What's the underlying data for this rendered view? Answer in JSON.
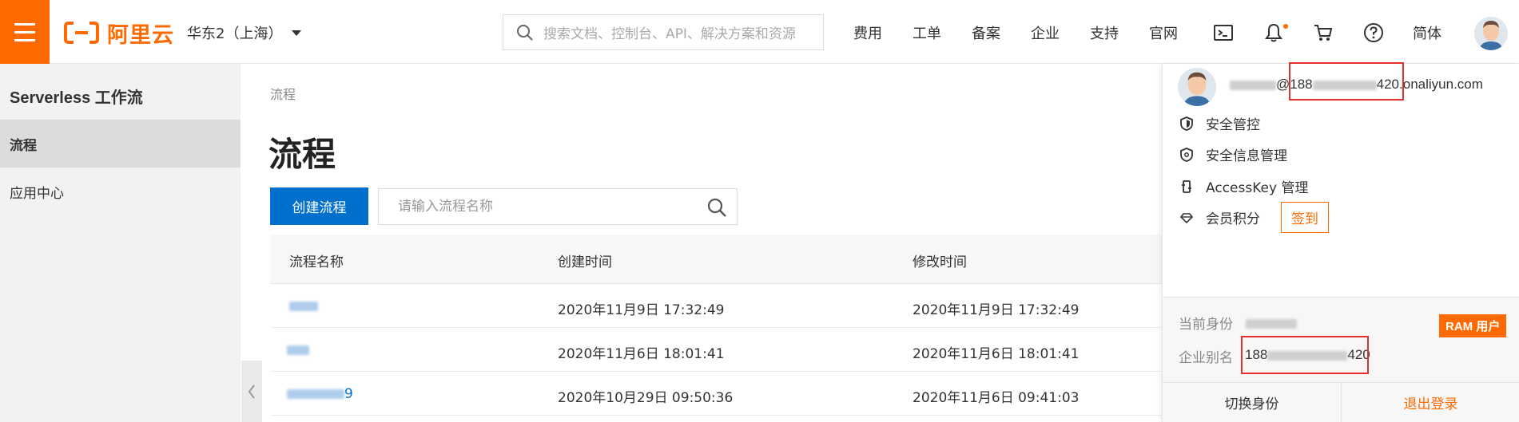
{
  "topbar": {
    "logo_text": "阿里云",
    "region": "华东2（上海）",
    "search_placeholder": "搜索文档、控制台、API、解决方案和资源",
    "nav": [
      "费用",
      "工单",
      "备案",
      "企业",
      "支持",
      "官网"
    ],
    "icons": [
      "terminal-icon",
      "bell-icon",
      "cart-icon",
      "help-icon"
    ],
    "language": "简体",
    "brand_color": "#ff6a00"
  },
  "sidebar": {
    "title": "Serverless 工作流",
    "items": [
      {
        "label": "流程",
        "active": true
      },
      {
        "label": "应用中心",
        "active": false
      }
    ]
  },
  "main": {
    "breadcrumb": "流程",
    "title": "流程",
    "create_button": "创建流程",
    "search_placeholder": "请输入流程名称",
    "columns": [
      "流程名称",
      "创建时间",
      "修改时间"
    ],
    "rows": [
      {
        "name_suffix": "",
        "created": "2020年11月9日 17:32:49",
        "modified": "2020年11月9日 17:32:49"
      },
      {
        "name_suffix": "",
        "created": "2020年11月6日 18:01:41",
        "modified": "2020年11月6日 18:01:41"
      },
      {
        "name_suffix": "9",
        "created": "2020年10月29日 09:50:36",
        "modified": "2020年11月6日 09:41:03"
      }
    ],
    "accent_color": "#0070cc"
  },
  "panel": {
    "account_at": "@",
    "account_prefix": "188",
    "account_suffix": "420",
    "account_domain": ".onaliyun.com",
    "menu": [
      {
        "label": "安全管控",
        "icon": "shield-icon"
      },
      {
        "label": "安全信息管理",
        "icon": "shield-check-icon"
      },
      {
        "label": "AccessKey 管理",
        "icon": "key-icon"
      },
      {
        "label": "会员积分",
        "icon": "diamond-icon"
      }
    ],
    "checkin_button": "签到",
    "identity_label": "当前身份",
    "ram_badge": "RAM 用户",
    "alias_label": "企业别名",
    "alias_prefix": "188",
    "alias_suffix": "420",
    "switch_button": "切换身份",
    "logout_button": "退出登录"
  }
}
